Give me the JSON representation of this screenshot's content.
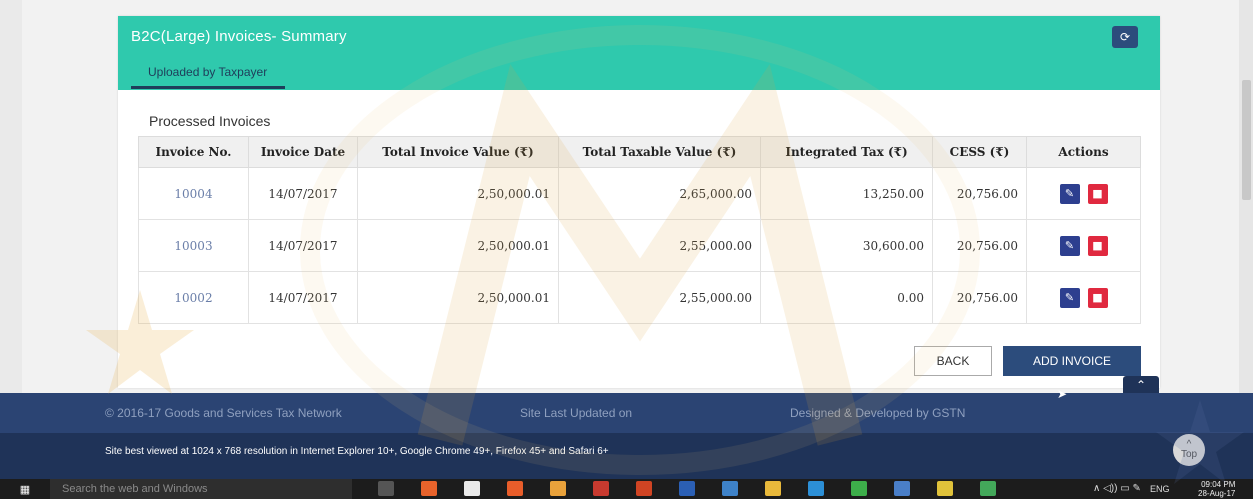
{
  "header": {
    "title": "B2C(Large) Invoices- Summary",
    "subtab": "Uploaded by Taxpayer",
    "refresh_icon": "refresh-icon"
  },
  "section_label": "Processed Invoices",
  "table": {
    "columns": [
      "Invoice No.",
      "Invoice Date",
      "Total Invoice Value (₹)",
      "Total Taxable Value (₹)",
      "Integrated Tax (₹)",
      "CESS (₹)",
      "Actions"
    ],
    "rows": [
      {
        "invoice_no": "10004",
        "date": "14/07/2017",
        "invoice_value": "2,50,000.01",
        "taxable_value": "2,65,000.00",
        "integrated_tax": "13,250.00",
        "cess": "20,756.00"
      },
      {
        "invoice_no": "10003",
        "date": "14/07/2017",
        "invoice_value": "2,50,000.01",
        "taxable_value": "2,55,000.00",
        "integrated_tax": "30,600.00",
        "cess": "20,756.00"
      },
      {
        "invoice_no": "10002",
        "date": "14/07/2017",
        "invoice_value": "2,50,000.01",
        "taxable_value": "2,55,000.00",
        "integrated_tax": "0.00",
        "cess": "20,756.00"
      }
    ]
  },
  "buttons": {
    "back": "BACK",
    "add_invoice": "ADD INVOICE"
  },
  "footer": {
    "copyright": "© 2016-17 Goods and Services Tax Network",
    "site_updated": "Site Last Updated on",
    "designed_by": "Designed & Developed by GSTN",
    "best_viewed": "Site best viewed at 1024 x 768 resolution in Internet Explorer 10+, Google Chrome 49+, Firefox 45+ and Safari 6+",
    "top_label": "Top"
  },
  "taskbar": {
    "search_placeholder": "Search the web and Windows",
    "language": "ENG",
    "time": "09:04 PM",
    "date": "28-Aug-17"
  },
  "colors": {
    "header_teal": "#2fc9ad",
    "navy": "#2c4c7c",
    "footer_dark": "#1f3358",
    "delete_red": "#e0293f"
  }
}
